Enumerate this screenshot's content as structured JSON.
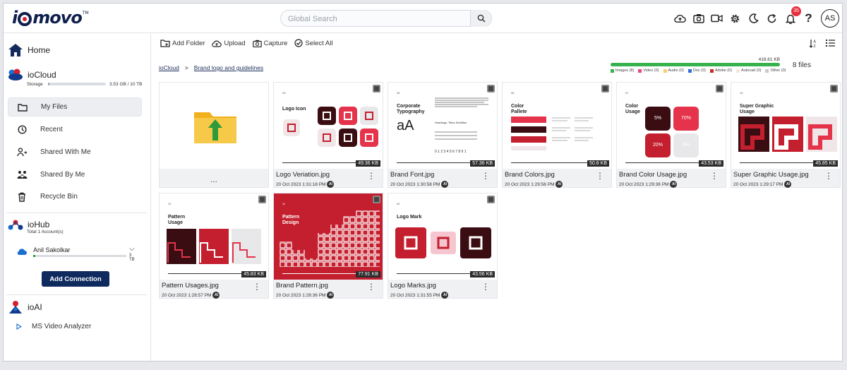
{
  "header": {
    "logo": "iomovo",
    "logo_tm": "TM",
    "search_placeholder": "Global Search",
    "notification_count": "35",
    "avatar_initials": "AS"
  },
  "sidebar": {
    "home": "Home",
    "iocloud": {
      "title": "ioCloud",
      "storage_label": "Storage",
      "storage_value": "3.53 GB / 10 TB",
      "storage_fraction": 0.03
    },
    "nav": [
      {
        "label": "My Files",
        "icon": "folder-icon",
        "active": true
      },
      {
        "label": "Recent",
        "icon": "clock-icon"
      },
      {
        "label": "Shared With Me",
        "icon": "user-share-icon"
      },
      {
        "label": "Shared By Me",
        "icon": "users-share-icon"
      },
      {
        "label": "Recycle Bin",
        "icon": "trash-icon"
      }
    ],
    "iohub": {
      "title": "ioHub",
      "subtitle": "Total 1 Account(s)"
    },
    "account": {
      "name": "Anil Sakolkar",
      "value": "3 TB",
      "fraction": 0.02
    },
    "add_connection": "Add Connection",
    "ioai": {
      "title": "ioAI",
      "item": "MS Video Analyzer"
    }
  },
  "toolbar": {
    "add_folder": "Add Folder",
    "upload": "Upload",
    "capture": "Capture",
    "select_all": "Select All"
  },
  "breadcrumb": {
    "root": "ioCloud",
    "separator": ">",
    "current": "Brand logo and guidelines"
  },
  "quota": {
    "total": "418.61 KB",
    "file_count": "8 files",
    "legend": [
      {
        "label": "Images (8)",
        "color": "#37b24d"
      },
      {
        "label": "Video (0)",
        "color": "#e64980"
      },
      {
        "label": "Audio (0)",
        "color": "#f5d06b"
      },
      {
        "label": "Doc (0)",
        "color": "#2f6fd6"
      },
      {
        "label": "Adobe (0)",
        "color": "#c92a2a"
      },
      {
        "label": "Autocad (0)",
        "color": "#f2e8d8"
      },
      {
        "label": "Other (0)",
        "color": "#c7c9cc"
      }
    ]
  },
  "folder_more": "...",
  "files": [
    {
      "name": "Logo Veriation.jpg",
      "date": "20 Oct 2023 1:31:18 PM",
      "size": "49.36 KB",
      "num": "03",
      "title": "Logo Icon"
    },
    {
      "name": "Brand Font.jpg",
      "date": "20 Oct 2023 1:30:58 PM",
      "size": "57.36 KB",
      "num": "05",
      "title": "Corporate Typography"
    },
    {
      "name": "Brand Colors.jpg",
      "date": "20 Oct 2023 1:29:56 PM",
      "size": "50.8 KB",
      "num": "06",
      "title": "Color Pallete"
    },
    {
      "name": "Brand Color Usage.jpg",
      "date": "20 Oct 2023 1:29:36 PM",
      "size": "43.53 KB",
      "num": "07",
      "title": "Color Usage"
    },
    {
      "name": "Super Graphic Usage.jpg",
      "date": "20 Oct 2023 1:29:17 PM",
      "size": "45.85 KB",
      "num": "10",
      "title": "Super Graphic Usage"
    },
    {
      "name": "Pattern Usages.jpg",
      "date": "20 Oct 2023 1:28:57 PM",
      "size": "45.83 KB",
      "num": "12",
      "title": "Pattern Usage"
    },
    {
      "name": "Brand Pattern.jpg",
      "date": "20 Oct 2023 1:28:36 PM",
      "size": "77.91 KB",
      "num": "11",
      "title": "Pattern Design"
    },
    {
      "name": "Logo Marks.jpg",
      "date": "20 Oct 2023 1:31:55 PM",
      "size": "43.56 KB",
      "num": "02",
      "title": "Logo Mark"
    }
  ],
  "design_text": {
    "typography_sample": "aA",
    "typography_notes": "Headings, Titles Subtitles",
    "typography_digits": "0 1 2 3 4 5 6 7 8 9 1",
    "color_chips": [
      "5%",
      "70%",
      "20%",
      "5%"
    ]
  },
  "ai_badge": "AI"
}
